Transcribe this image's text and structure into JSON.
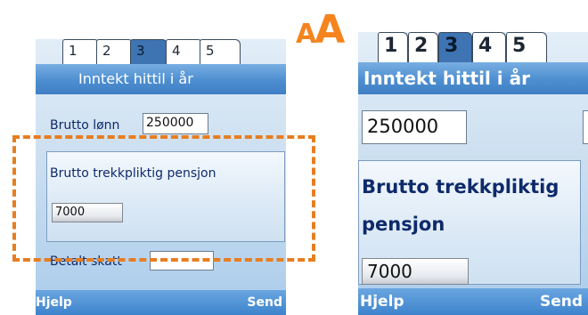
{
  "tabs": [
    "1",
    "2",
    "3",
    "4",
    "5"
  ],
  "active_tab_index": 2,
  "title": "Inntekt hittil i år",
  "fields": {
    "brutto_lonn": {
      "label": "Brutto lønn",
      "value": "250000"
    },
    "brutto_pensjon": {
      "label": "Brutto trekkpliktig pensjon",
      "label_line1": "Brutto trekkpliktig",
      "label_line2": "pensjon",
      "value": "7000"
    },
    "betalt_skatt": {
      "label": "Betalt skatt",
      "value": ""
    }
  },
  "softkeys": {
    "left": "Hjelp",
    "right": "Send",
    "right_truncated": "Send"
  },
  "zoom_icon": {
    "small": "A",
    "big": "A"
  },
  "colors": {
    "highlight": "#e67e22",
    "zoom_icon": "#f5841f",
    "title_bar": "#4d8ed0",
    "active_tab": "#3f74b3",
    "label_text": "#0e2a6a"
  }
}
